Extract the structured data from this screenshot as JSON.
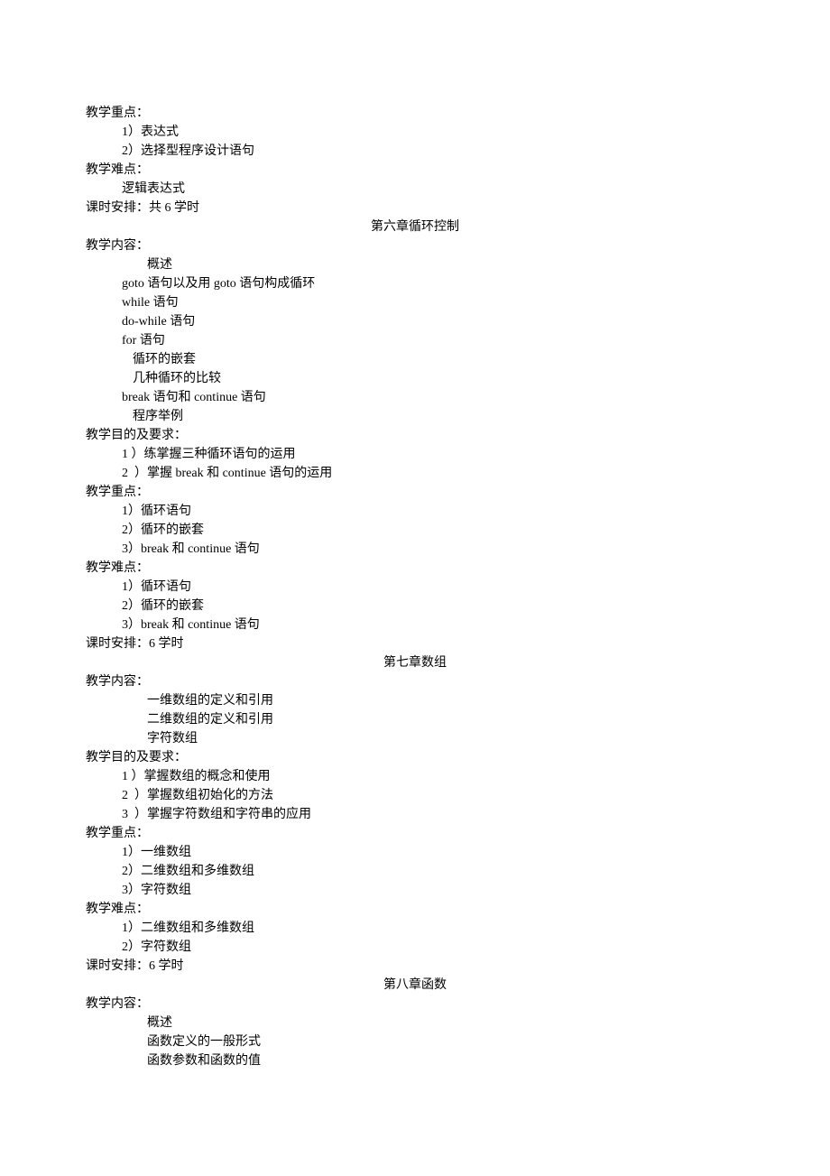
{
  "lines": [
    {
      "cls": "indent-0",
      "text": "教学重点："
    },
    {
      "cls": "indent-1",
      "text": "1）表达式"
    },
    {
      "cls": "indent-1",
      "text": "2）选择型程序设计语句"
    },
    {
      "cls": "indent-0",
      "text": "教学难点："
    },
    {
      "cls": "indent-1",
      "text": "逻辑表达式"
    },
    {
      "cls": "indent-0",
      "text": "课时安排：共 6 学时"
    },
    {
      "cls": "chapter-title",
      "text": "第六章循环控制"
    },
    {
      "cls": "indent-0",
      "text": "教学内容："
    },
    {
      "cls": "indent-3",
      "text": "概述"
    },
    {
      "cls": "indent-1",
      "text": "goto 语句以及用 goto 语句构成循环"
    },
    {
      "cls": "indent-1",
      "text": "while 语句"
    },
    {
      "cls": "indent-1",
      "text": "do-while 语句"
    },
    {
      "cls": "indent-1",
      "text": "for 语句"
    },
    {
      "cls": "indent-2",
      "text": "循环的嵌套"
    },
    {
      "cls": "indent-2",
      "text": "几种循环的比较"
    },
    {
      "cls": "indent-1",
      "text": "break 语句和 continue 语句"
    },
    {
      "cls": "indent-2",
      "text": "程序举例"
    },
    {
      "cls": "indent-0",
      "text": "教学目的及要求："
    },
    {
      "cls": "indent-1",
      "text": "1 ）练掌握三种循环语句的运用"
    },
    {
      "cls": "indent-1",
      "text": "2  ）掌握 break 和 continue 语句的运用"
    },
    {
      "cls": "indent-0",
      "text": "教学重点："
    },
    {
      "cls": "indent-1",
      "text": "1）循环语句"
    },
    {
      "cls": "indent-1",
      "text": "2）循环的嵌套"
    },
    {
      "cls": "indent-1",
      "text": "3）break 和 continue 语句"
    },
    {
      "cls": "indent-0",
      "text": "教学难点："
    },
    {
      "cls": "indent-1",
      "text": "1）循环语句"
    },
    {
      "cls": "indent-1",
      "text": "2）循环的嵌套"
    },
    {
      "cls": "indent-1",
      "text": "3）break 和 continue 语句"
    },
    {
      "cls": "indent-0",
      "text": "课时安排：6 学时"
    },
    {
      "cls": "chapter-title",
      "text": "第七章数组"
    },
    {
      "cls": "indent-0",
      "text": "教学内容："
    },
    {
      "cls": "indent-3",
      "text": "一维数组的定义和引用"
    },
    {
      "cls": "indent-3",
      "text": "二维数组的定义和引用"
    },
    {
      "cls": "indent-3",
      "text": "字符数组"
    },
    {
      "cls": "indent-0",
      "text": "教学目的及要求："
    },
    {
      "cls": "indent-1",
      "text": "1 ）掌握数组的概念和使用"
    },
    {
      "cls": "indent-1",
      "text": "2  ）掌握数组初始化的方法"
    },
    {
      "cls": "indent-1",
      "text": "3  ）掌握字符数组和字符串的应用"
    },
    {
      "cls": "indent-0",
      "text": "教学重点："
    },
    {
      "cls": "indent-1",
      "text": "1）一维数组"
    },
    {
      "cls": "indent-1",
      "text": "2）二维数组和多维数组"
    },
    {
      "cls": "indent-1",
      "text": "3）字符数组"
    },
    {
      "cls": "indent-0",
      "text": "教学难点："
    },
    {
      "cls": "indent-1",
      "text": "1）二维数组和多维数组"
    },
    {
      "cls": "indent-1",
      "text": "2）字符数组"
    },
    {
      "cls": "indent-0",
      "text": "课时安排：6 学时"
    },
    {
      "cls": "chapter-title",
      "text": "第八章函数"
    },
    {
      "cls": "indent-0",
      "text": "教学内容："
    },
    {
      "cls": "indent-3",
      "text": "概述"
    },
    {
      "cls": "indent-3",
      "text": "函数定义的一般形式"
    },
    {
      "cls": "indent-3",
      "text": "函数参数和函数的值"
    }
  ]
}
